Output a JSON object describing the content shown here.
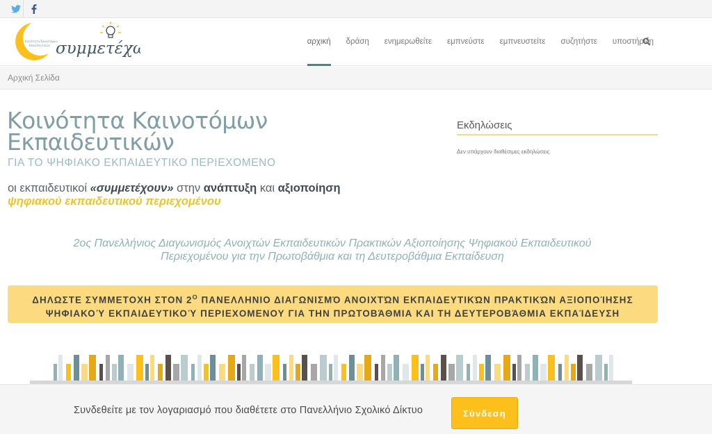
{
  "social": {
    "twitter_icon": "twitter-icon",
    "facebook_icon": "facebook-icon"
  },
  "header": {
    "logo_text": "συμμετέχω",
    "nav": [
      {
        "label": "αρχική",
        "active": true
      },
      {
        "label": "δράση",
        "active": false
      },
      {
        "label": "ενημερωθείτε",
        "active": false
      },
      {
        "label": "εμπνεύστε",
        "active": false
      },
      {
        "label": "εμπνευστείτε",
        "active": false
      },
      {
        "label": "συζητήστε",
        "active": false
      },
      {
        "label": "υποστήριξη",
        "active": false
      }
    ],
    "search_icon": "search-icon"
  },
  "breadcrumb": "Αρχική Σελίδα",
  "main": {
    "title_line1": "Κοινότητα Καινοτόμων",
    "title_line2": "Εκπαιδευτικών",
    "subtitle": "ΓΙΑ ΤΟ ΨΗΦΙΑΚΟ ΕΚΠΑΙΔΕΥΤΙΚΟ ΠΕΡΙΕΧΟΜΕΝΟ",
    "tagline": {
      "part1": "οι εκπαιδευτικοί ",
      "part2": "«συμμετέχουν»",
      "part3": " στην ",
      "part4": "ανάπτυξη",
      "part5": " και ",
      "part6": "αξιοποίηση",
      "part7": "ψηφιακού εκπαιδευτικού περιεχομένου"
    },
    "contest_line1": "2ος Πανελλήνιος Διαγωνισμός Ανοιχτών Εκπαιδευτικών Πρακτικών Αξιοποίησης Ψηφιακού Εκπαιδευτικού",
    "contest_line2": "Περιεχομένου για την Πρωτοβάθμια και τη Δευτεροβάθμια Εκπαίδευση",
    "banner_line1_a": "ΔΗΛΩΣΤΕ ΣΥΜΜΕΤΟΧΗ ΣΤΟΝ 2",
    "banner_line1_sup": "Ο",
    "banner_line1_b": " ΠΑΝΕΛΛΗΝΙΟ ΔΙΑΓΩΝΙΣΜΌ ΑΝΟΙΧΤΏΝ ΕΚΠΑΙΔΕΥΤΙΚΏΝ ΠΡΑΚΤΙΚΏΝ ΑΞΙΟΠΟΊΗΣΗΣ",
    "banner_line2": "ΨΗΦΙΑΚΟΎ ΕΚΠΑΙΔΕΥΤΙΚΟΎ ΠΕΡΙΕΧΟΜΕΝΟΥ ΓΙΑ ΤΗΝ ΠΡΩΤΟΒΆΘΜΙΑ ΚΑΙ ΤΗ ΔΕΥΤΕΡΟΒΆΘΜΙΑ ΕΚΠΑΊΔΕΥΣΗ"
  },
  "sidebar": {
    "title": "Εκδηλώσεις",
    "empty_text": "Δεν υπάρχουν διαθέσιμες εκδηλώσεις"
  },
  "login": {
    "text": "Συνδεθείτε με τον λογαριασμό που διαθέτετε στο Πανελλήνιο Σχολικό Δίκτυο",
    "button": "Σύνδεση"
  },
  "colors": {
    "accent_yellow": "#fcbf1b",
    "banner_yellow": "#fcdb80",
    "teal": "#7f9ea5",
    "twitter": "#55acee",
    "facebook": "#3b5998"
  }
}
